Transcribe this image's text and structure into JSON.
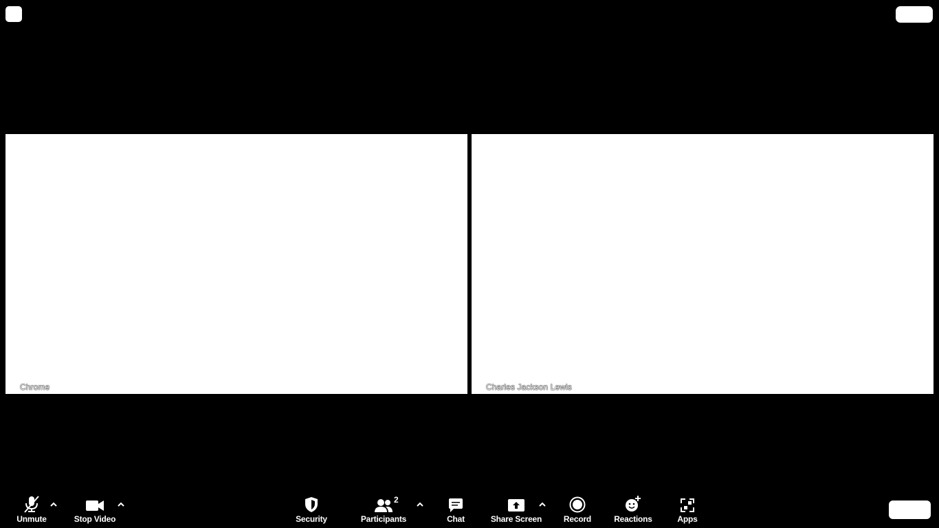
{
  "tiles": [
    {
      "name": "Chrome"
    },
    {
      "name": "Charles Jackson Lewis"
    }
  ],
  "toolbar": {
    "unmute": {
      "label": "Unmute",
      "icon": "microphone-muted-icon"
    },
    "video": {
      "label": "Stop Video",
      "icon": "video-camera-icon"
    },
    "security": {
      "label": "Security",
      "icon": "shield-icon"
    },
    "participants": {
      "label": "Participants",
      "count": "2",
      "icon": "participants-icon"
    },
    "chat": {
      "label": "Chat",
      "icon": "chat-bubble-icon"
    },
    "share": {
      "label": "Share Screen",
      "icon": "share-screen-icon"
    },
    "record": {
      "label": "Record",
      "icon": "record-icon"
    },
    "reactions": {
      "label": "Reactions",
      "icon": "smile-plus-icon"
    },
    "apps": {
      "label": "Apps",
      "icon": "apps-icon"
    }
  },
  "colors": {
    "background": "#000000",
    "foreground": "#ffffff"
  }
}
